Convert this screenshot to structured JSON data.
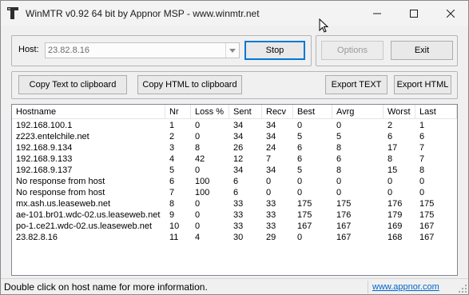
{
  "window": {
    "title": "WinMTR v0.92 64 bit by Appnor MSP - www.winmtr.net"
  },
  "icons": {
    "app": "winmtr-app-icon",
    "minimize": "minimize-icon",
    "maximize": "maximize-icon",
    "close": "close-icon",
    "dropdown": "chevron-down-icon",
    "cursor": "mouse-cursor-icon"
  },
  "controls": {
    "host_label": "Host:",
    "host_value": "23.82.8.16",
    "stop_label": "Stop",
    "options_label": "Options",
    "exit_label": "Exit",
    "copy_text_label": "Copy Text to clipboard",
    "copy_html_label": "Copy HTML to clipboard",
    "export_text_label": "Export TEXT",
    "export_html_label": "Export HTML"
  },
  "table": {
    "columns": [
      "Hostname",
      "Nr",
      "Loss %",
      "Sent",
      "Recv",
      "Best",
      "Avrg",
      "Worst",
      "Last"
    ],
    "rows": [
      [
        "192.168.100.1",
        "1",
        "0",
        "34",
        "34",
        "0",
        "0",
        "2",
        "1"
      ],
      [
        "z223.entelchile.net",
        "2",
        "0",
        "34",
        "34",
        "5",
        "5",
        "6",
        "6"
      ],
      [
        "192.168.9.134",
        "3",
        "8",
        "26",
        "24",
        "6",
        "8",
        "17",
        "7"
      ],
      [
        "192.168.9.133",
        "4",
        "42",
        "12",
        "7",
        "6",
        "6",
        "8",
        "7"
      ],
      [
        "192.168.9.137",
        "5",
        "0",
        "34",
        "34",
        "5",
        "8",
        "15",
        "8"
      ],
      [
        "No response from host",
        "6",
        "100",
        "6",
        "0",
        "0",
        "0",
        "0",
        "0"
      ],
      [
        "No response from host",
        "7",
        "100",
        "6",
        "0",
        "0",
        "0",
        "0",
        "0"
      ],
      [
        "mx.ash.us.leaseweb.net",
        "8",
        "0",
        "33",
        "33",
        "175",
        "175",
        "176",
        "175"
      ],
      [
        "ae-101.br01.wdc-02.us.leaseweb.net",
        "9",
        "0",
        "33",
        "33",
        "175",
        "176",
        "179",
        "175"
      ],
      [
        "po-1.ce21.wdc-02.us.leaseweb.net",
        "10",
        "0",
        "33",
        "33",
        "167",
        "167",
        "169",
        "167"
      ],
      [
        "23.82.8.16",
        "11",
        "4",
        "30",
        "29",
        "0",
        "167",
        "168",
        "167"
      ]
    ]
  },
  "status": {
    "message": "Double click on host name for more information.",
    "link": "www.appnor.com"
  }
}
